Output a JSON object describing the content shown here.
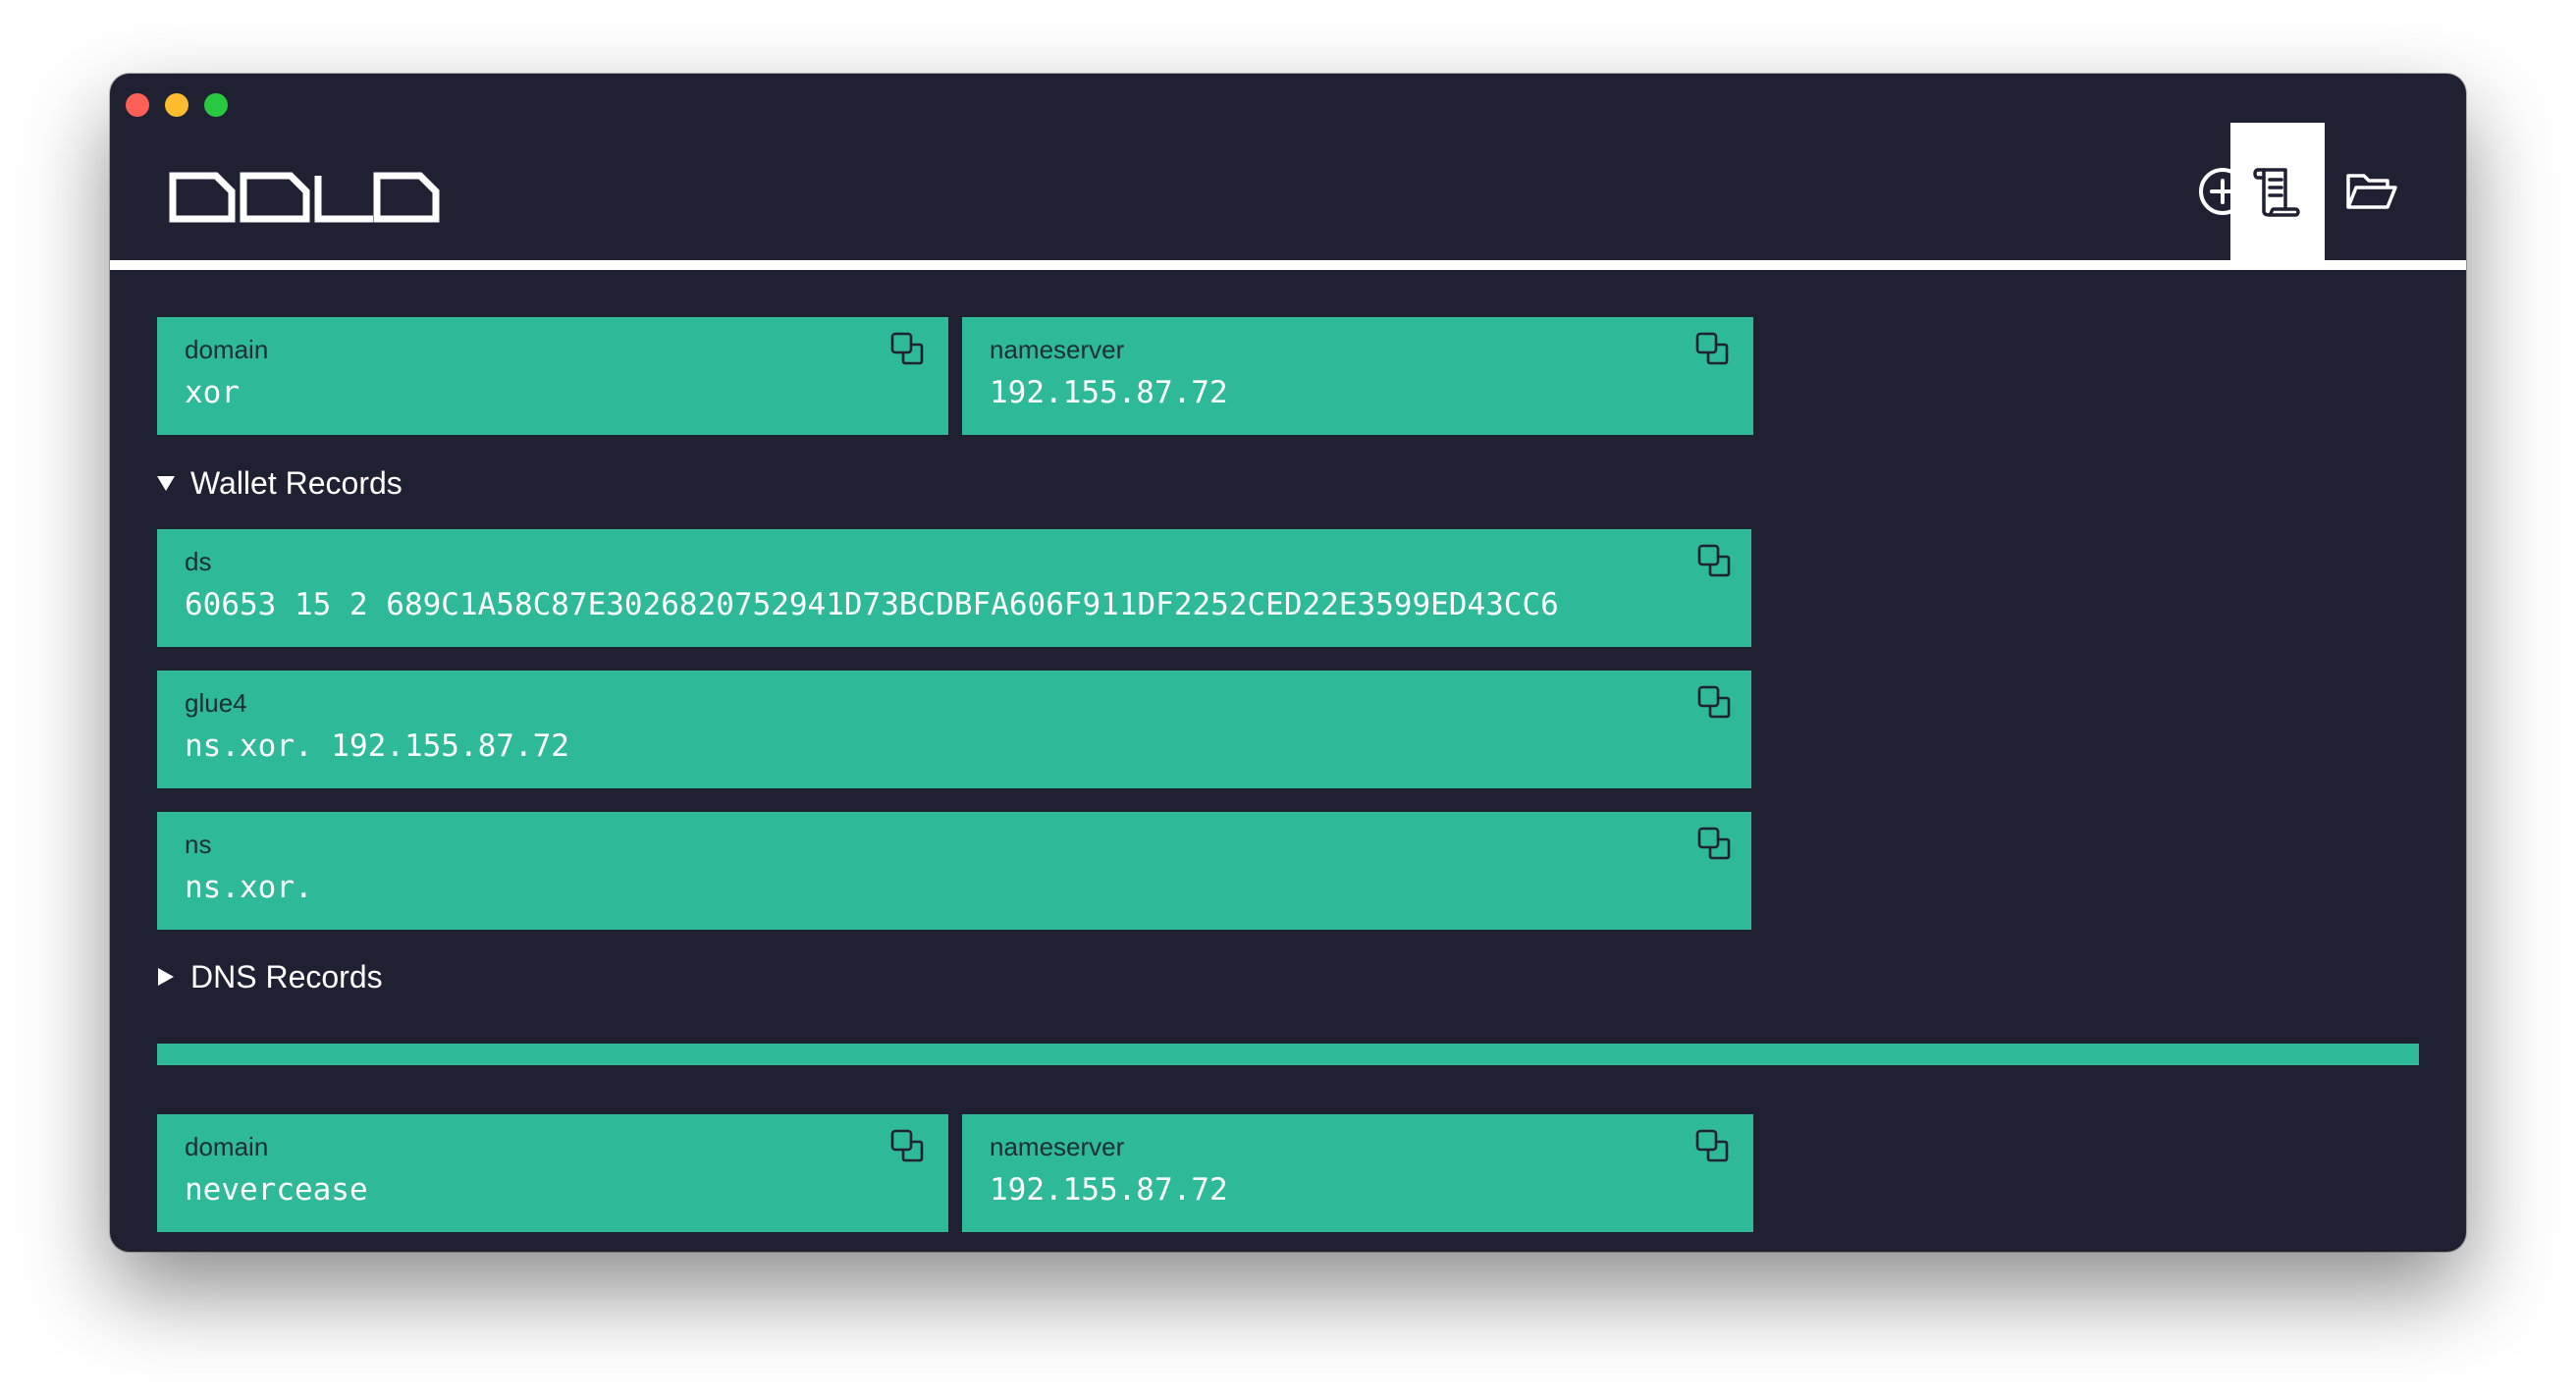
{
  "window": {
    "traffic_lights": {
      "close_color": "#fe5f57",
      "minimize_color": "#febc2e",
      "maximize_color": "#28c840"
    }
  },
  "header": {
    "logo_text": "DOLO",
    "toolbar": [
      {
        "icon": "add-circle-icon",
        "active": false
      },
      {
        "icon": "scroll-document-icon",
        "active": true
      },
      {
        "icon": "folder-open-icon",
        "active": false
      }
    ]
  },
  "colors": {
    "background": "#1f2132",
    "card": "#2eb999",
    "label_text": "#1a2f33",
    "value_text": "#ffffff"
  },
  "entries": [
    {
      "domain": {
        "label": "domain",
        "value": "xor"
      },
      "nameserver": {
        "label": "nameserver",
        "value": "192.155.87.72"
      },
      "wallet_section": {
        "title": "Wallet Records",
        "expanded": true,
        "records": [
          {
            "label": "ds",
            "value": "60653 15 2 689C1A58C87E3026820752941D73BCDBFA606F911DF2252CED22E3599ED43CC6"
          },
          {
            "label": "glue4",
            "value": "ns.xor. 192.155.87.72"
          },
          {
            "label": "ns",
            "value": "ns.xor."
          }
        ]
      },
      "dns_section": {
        "title": "DNS Records",
        "expanded": false
      }
    },
    {
      "domain": {
        "label": "domain",
        "value": "nevercease"
      },
      "nameserver": {
        "label": "nameserver",
        "value": "192.155.87.72"
      }
    }
  ]
}
